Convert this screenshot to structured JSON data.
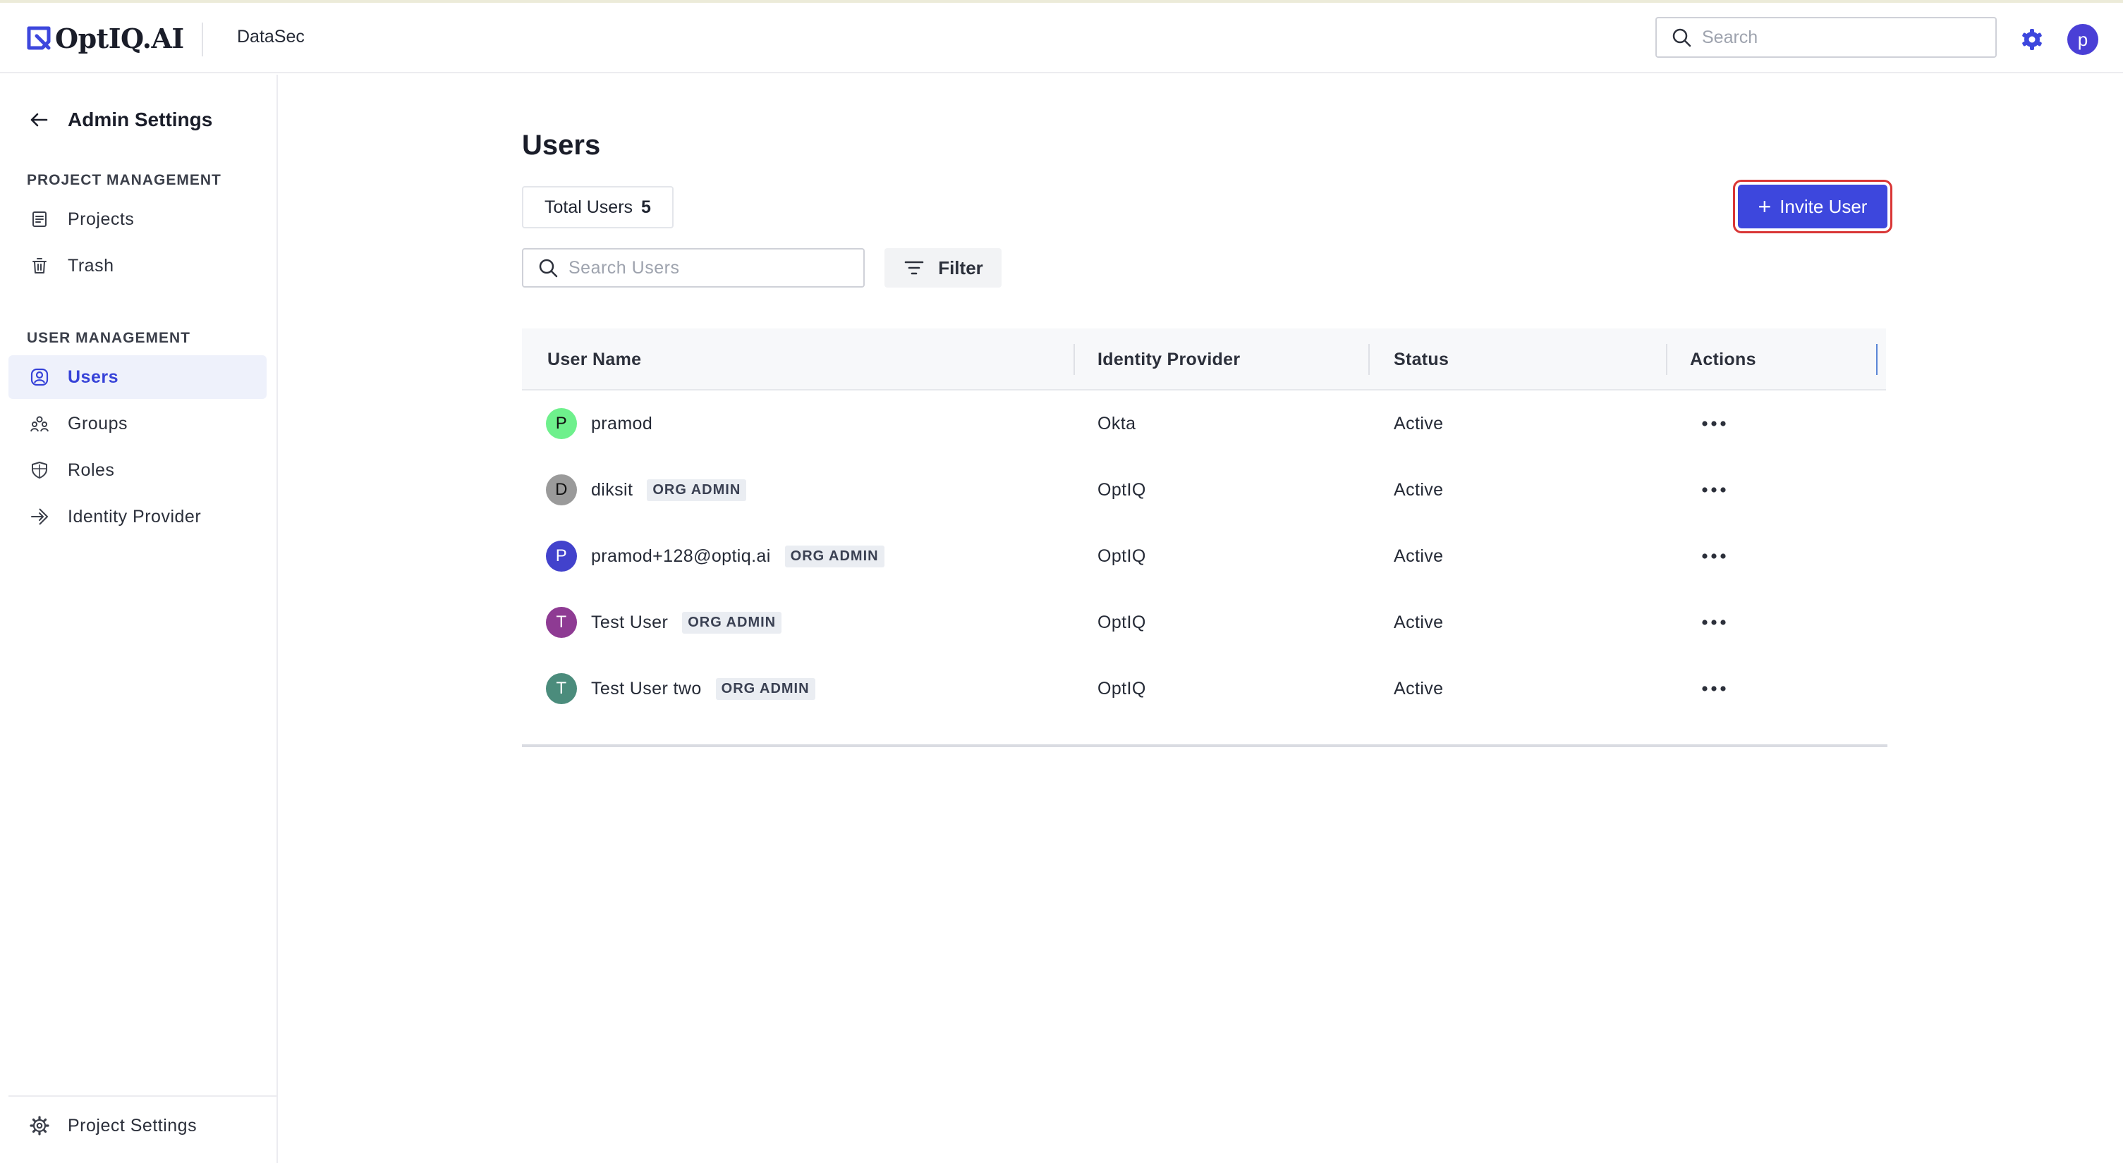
{
  "header": {
    "logo_text": "OptIQ.AI",
    "workspace": "DataSec",
    "search_placeholder": "Search",
    "user_initial": "p"
  },
  "sidebar": {
    "back_title": "Admin Settings",
    "sections": [
      {
        "label": "PROJECT MANAGEMENT",
        "items": [
          {
            "label": "Projects",
            "icon": "document-icon"
          },
          {
            "label": "Trash",
            "icon": "trash-icon"
          }
        ]
      },
      {
        "label": "USER MANAGEMENT",
        "items": [
          {
            "label": "Users",
            "icon": "user-circle-icon",
            "active": true
          },
          {
            "label": "Groups",
            "icon": "groups-icon"
          },
          {
            "label": "Roles",
            "icon": "shield-icon"
          },
          {
            "label": "Identity Provider",
            "icon": "login-icon"
          }
        ]
      }
    ],
    "bottom": {
      "label": "Project Settings",
      "icon": "gear-icon"
    }
  },
  "main": {
    "title": "Users",
    "total_users_label": "Total Users",
    "total_users_count": "5",
    "invite_label": "Invite User",
    "search_placeholder": "Search Users",
    "filter_label": "Filter",
    "table": {
      "columns": [
        "User Name",
        "Identity Provider",
        "Status",
        "Actions"
      ],
      "rows": [
        {
          "initial": "P",
          "avatar_color": "#6ef08c",
          "name": "pramod",
          "badge": "",
          "provider": "Okta",
          "status": "Active"
        },
        {
          "initial": "D",
          "avatar_color": "#9a9a9a",
          "name": "diksit",
          "badge": "ORG ADMIN",
          "provider": "OptIQ",
          "status": "Active"
        },
        {
          "initial": "P",
          "avatar_color": "#4242cc",
          "name": "pramod+128@optiq.ai",
          "badge": "ORG ADMIN",
          "provider": "OptIQ",
          "status": "Active"
        },
        {
          "initial": "T",
          "avatar_color": "#8e3b93",
          "name": "Test User",
          "badge": "ORG ADMIN",
          "provider": "OptIQ",
          "status": "Active"
        },
        {
          "initial": "T",
          "avatar_color": "#4b8c7c",
          "name": "Test User two",
          "badge": "ORG ADMIN",
          "provider": "OptIQ",
          "status": "Active"
        }
      ]
    }
  },
  "colors": {
    "accent": "#3d47dd",
    "active_nav_bg": "#eef1fb",
    "highlight_outline": "#d93636"
  }
}
